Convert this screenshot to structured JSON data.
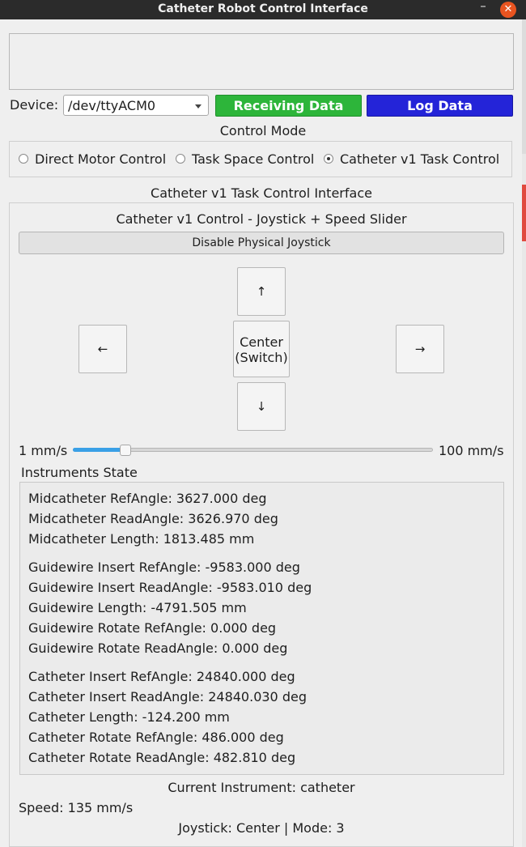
{
  "window": {
    "title": "Catheter Robot Control Interface",
    "minimize_glyph": "–",
    "close_glyph": "✕"
  },
  "device": {
    "label": "Device:",
    "selected": "/dev/ttyACM0",
    "receiving_button": "Receiving Data",
    "log_button": "Log Data"
  },
  "control_mode": {
    "label": "Control Mode",
    "options": [
      {
        "label": "Direct Motor Control",
        "checked": false
      },
      {
        "label": "Task Space Control",
        "checked": false
      },
      {
        "label": "Catheter v1 Task Control",
        "checked": true
      }
    ]
  },
  "interface": {
    "group_label": "Catheter v1 Task Control Interface",
    "title": "Catheter v1 Control - Joystick + Speed Slider",
    "joystick_toggle": "Disable Physical Joystick",
    "buttons": {
      "up": "↑",
      "left": "←",
      "right": "→",
      "down": "↓",
      "center_line1": "Center",
      "center_line2": "(Switch)"
    },
    "slider": {
      "min_label": "1 mm/s",
      "max_label": "100 mm/s",
      "level_percent": 15
    }
  },
  "instruments": {
    "label": "Instruments State",
    "lines": [
      "Midcatheter RefAngle: 3627.000 deg",
      "Midcatheter ReadAngle: 3626.970 deg",
      "Midcatheter Length: 1813.485 mm",
      "Guidewire Insert RefAngle: -9583.000 deg",
      "Guidewire Insert ReadAngle: -9583.010 deg",
      "Guidewire Length: -4791.505 mm",
      "Guidewire Rotate RefAngle: 0.000 deg",
      "Guidewire Rotate ReadAngle: 0.000 deg",
      "Catheter Insert RefAngle: 24840.000 deg",
      "Catheter Insert ReadAngle: 24840.030 deg",
      "Catheter Length: -124.200 mm",
      "Catheter Rotate RefAngle: 486.000 deg",
      "Catheter Rotate ReadAngle: 482.810 deg"
    ]
  },
  "status": {
    "current_instrument": "Current Instrument: catheter",
    "speed": "Speed: 135 mm/s",
    "joystick": "Joystick: Center | Mode: 3"
  },
  "colors": {
    "receiving": "#2db53a",
    "log": "#2424d8",
    "slider_fill": "#3aa0e6",
    "close": "#e95420"
  }
}
